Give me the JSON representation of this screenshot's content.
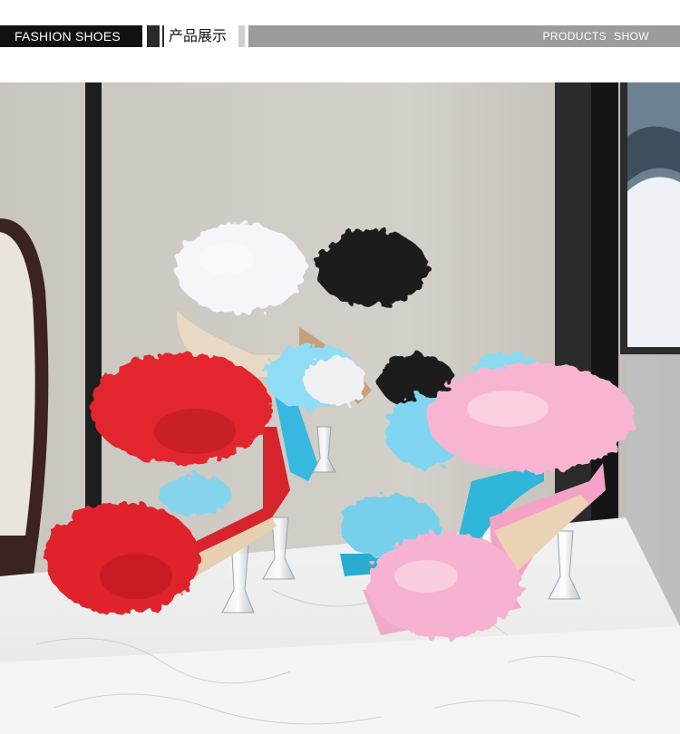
{
  "header": {
    "left_tag": "FASHION SHOES",
    "cn_title": "产品展示",
    "right_text_1": "PRODUCTS",
    "right_text_2": "SHOW"
  },
  "photo": {
    "subject": "feather-sandals-photo",
    "colors": {
      "wall": "#cfcac3",
      "marble": "#efefef",
      "red": "#e0242c",
      "pink": "#f6b3d0",
      "blue": "#6fd1ee",
      "white": "#f4f4f7",
      "black": "#1a1a1a"
    }
  }
}
